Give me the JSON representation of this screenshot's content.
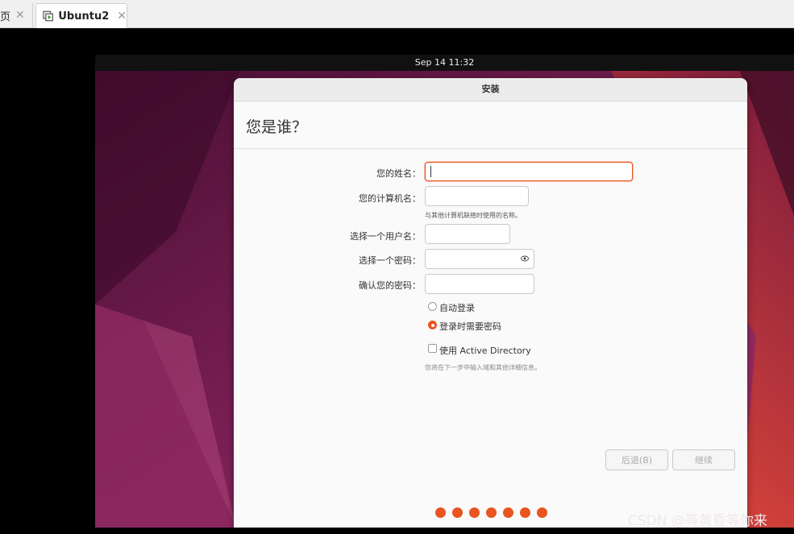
{
  "host": {
    "tabs": [
      {
        "label": "页",
        "close": "✕"
      },
      {
        "label": "Ubuntu2",
        "close": "✕"
      }
    ]
  },
  "vm": {
    "clock": "Sep 14  11:32",
    "window_title": "安装",
    "page_title": "您是谁？",
    "form": {
      "name_label": "您的姓名：",
      "computer_label": "您的计算机名：",
      "computer_hint": "与其他计算机联络时使用的名称。",
      "username_label": "选择一个用户名：",
      "password_label": "选择一个密码：",
      "confirm_label": "确认您的密码：",
      "auto_login": "自动登录",
      "require_password": "登录时需要密码",
      "active_directory": "使用 Active Directory",
      "ad_hint": "您将在下一步中输入域和其他详细信息。",
      "selected_login_option": "登录时需要密码"
    },
    "buttons": {
      "back": "后退(B)",
      "continue": "继续"
    },
    "progress": {
      "completed_steps": 7
    },
    "accent_color": "#e95420"
  },
  "watermark": "CSDN @等黄昏等你来"
}
